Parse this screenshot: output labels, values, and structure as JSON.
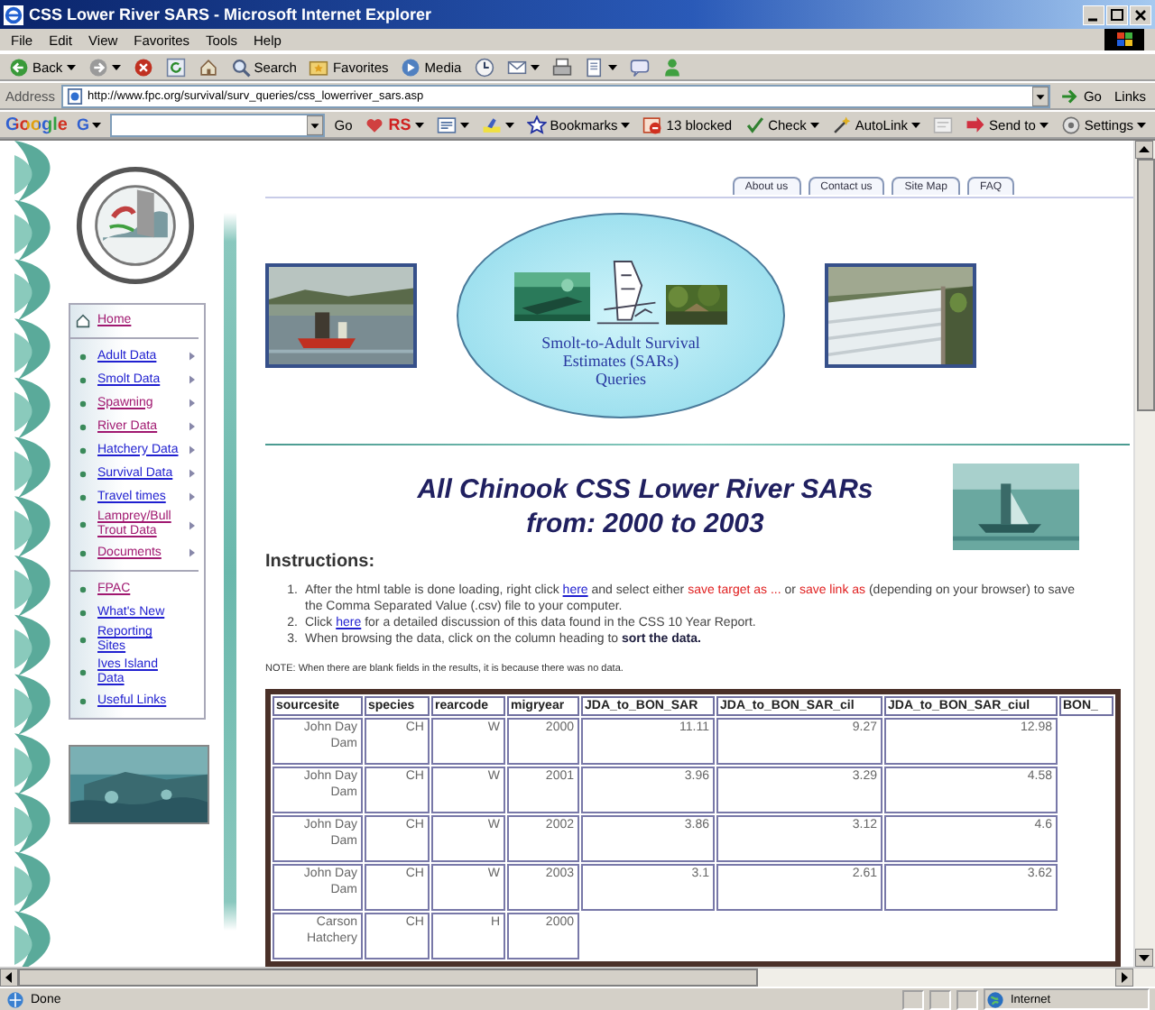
{
  "window": {
    "title": "CSS Lower River SARS - Microsoft Internet Explorer"
  },
  "menu": [
    "File",
    "Edit",
    "View",
    "Favorites",
    "Tools",
    "Help"
  ],
  "toolbar": [
    {
      "label": "Back",
      "caret": true
    },
    {
      "caret": true
    },
    {
      "caret": false
    },
    {
      "caret": false
    },
    {
      "caret": false
    },
    {
      "label": "Search",
      "caret": false
    },
    {
      "label": "Favorites",
      "caret": false
    },
    {
      "label": "Media",
      "caret": false
    },
    {
      "caret": false
    },
    {
      "caret": true
    },
    {
      "caret": false
    },
    {
      "caret": true
    },
    {
      "caret": false
    },
    {
      "caret": false
    }
  ],
  "address": {
    "label": "Address",
    "url": "http://www.fpc.org/survival/surv_queries/css_lowerriver_sars.asp",
    "go": "Go",
    "links": "Links"
  },
  "google_bar": {
    "logo": "Google",
    "g_menu": "G",
    "go": "Go",
    "tools": [
      {
        "label": "RS",
        "caret": true
      },
      {
        "caret": true
      },
      {
        "caret": true
      },
      {
        "label": "Bookmarks",
        "caret": true
      },
      {
        "label": "13 blocked",
        "caret": false
      },
      {
        "label": "Check",
        "caret": true
      },
      {
        "label": "AutoLink",
        "caret": true
      },
      {
        "caret": false
      },
      {
        "label": "Send to",
        "caret": true
      },
      {
        "label": "Settings",
        "caret": true
      }
    ]
  },
  "site": {
    "tabs": [
      "About us",
      "Contact us",
      "Site Map",
      "FAQ"
    ],
    "banner_caption": [
      "Smolt-to-Adult Survival",
      "Estimates (SARs)",
      "Queries"
    ],
    "nav": {
      "home": {
        "label": "Home",
        "visited": true
      },
      "primary": [
        {
          "label": "Adult Data",
          "visited": false,
          "submenu": true
        },
        {
          "label": "Smolt Data",
          "visited": false,
          "submenu": true
        },
        {
          "label": "Spawning",
          "visited": true,
          "submenu": true
        },
        {
          "label": "River Data",
          "visited": true,
          "submenu": true
        },
        {
          "label": "Hatchery Data",
          "visited": false,
          "submenu": true
        },
        {
          "label": "Survival Data",
          "visited": false,
          "submenu": true
        },
        {
          "label": "Travel times",
          "visited": false,
          "submenu": true
        },
        {
          "label": "Lamprey/Bull Trout Data",
          "visited": true,
          "submenu": true
        },
        {
          "label": "Documents",
          "visited": true,
          "submenu": true
        }
      ],
      "secondary": [
        {
          "label": "FPAC",
          "visited": true,
          "submenu": false
        },
        {
          "label": "What's New",
          "visited": false,
          "submenu": false
        },
        {
          "label": "Reporting Sites",
          "visited": false,
          "submenu": false
        },
        {
          "label": "Ives Island Data",
          "visited": false,
          "submenu": false
        },
        {
          "label": "Useful Links",
          "visited": false,
          "submenu": false
        }
      ]
    },
    "heading": [
      "All Chinook CSS Lower River SARs",
      "from: 2000 to 2003"
    ],
    "instructions": {
      "title": "Instructions:",
      "items": [
        {
          "number": "1.",
          "parts": [
            {
              "kind": "text",
              "text": "After the html table is done loading, right click "
            },
            {
              "kind": "link",
              "text": "here"
            },
            {
              "kind": "text",
              "text": " and select either "
            },
            {
              "kind": "red",
              "text": "save target as ..."
            },
            {
              "kind": "text",
              "text": " or "
            },
            {
              "kind": "red",
              "text": "save link as"
            },
            {
              "kind": "text",
              "text": " (depending on your browser) to save the Comma Separated Value (.csv) file to your computer."
            }
          ]
        },
        {
          "number": "2.",
          "parts": [
            {
              "kind": "text",
              "text": "Click "
            },
            {
              "kind": "link",
              "text": "here"
            },
            {
              "kind": "text",
              "text": " for a detailed discussion of this data found in the CSS 10 Year Report."
            }
          ]
        },
        {
          "number": "3.",
          "parts": [
            {
              "kind": "text",
              "text": "When browsing the data, click on the column heading to "
            },
            {
              "kind": "bold",
              "text": "sort the data."
            }
          ]
        }
      ]
    },
    "note": "NOTE: When there are blank fields in the results, it is because there was no data.",
    "table": {
      "columns": [
        "sourcesite",
        "species",
        "rearcode",
        "migryear",
        "JDA_to_BON_SAR",
        "JDA_to_BON_SAR_cil",
        "JDA_to_BON_SAR_ciul",
        "BON_"
      ],
      "rows": [
        {
          "cells": [
            "John Day Dam",
            "CH",
            "W",
            "2000",
            "11.11",
            "9.27",
            "12.98"
          ]
        },
        {
          "cells": [
            "John Day Dam",
            "CH",
            "W",
            "2001",
            "3.96",
            "3.29",
            "4.58"
          ]
        },
        {
          "cells": [
            "John Day Dam",
            "CH",
            "W",
            "2002",
            "3.86",
            "3.12",
            "4.6"
          ]
        },
        {
          "cells": [
            "John Day Dam",
            "CH",
            "W",
            "2003",
            "3.1",
            "2.61",
            "3.62"
          ]
        },
        {
          "cells": [
            "Carson Hatchery",
            "CH",
            "H",
            "2000"
          ]
        }
      ]
    }
  },
  "status_bar": {
    "text": "Done",
    "zone": "Internet"
  }
}
